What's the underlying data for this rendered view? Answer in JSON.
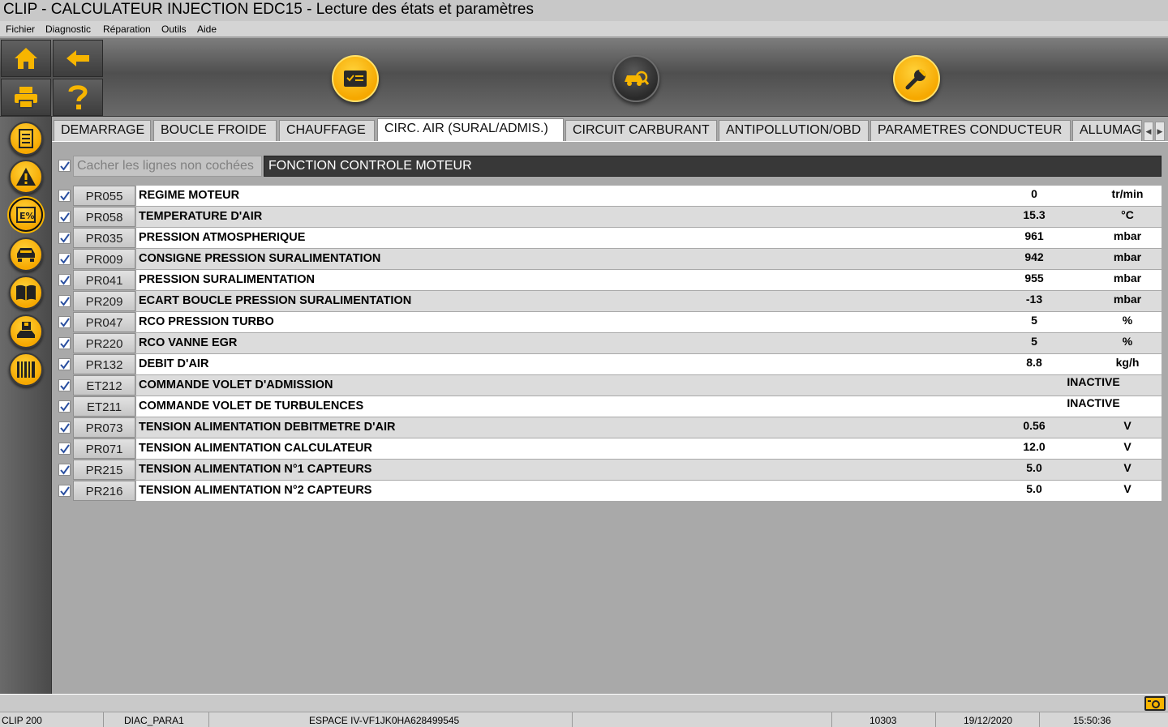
{
  "window": {
    "title": "CLIP - CALCULATEUR INJECTION EDC15 - Lecture des états et paramètres"
  },
  "menu": [
    "Fichier",
    "Diagnostic",
    "Réparation",
    "Outils",
    "Aide"
  ],
  "toolbar": {
    "left_buttons": [
      "home-icon",
      "back-arrow-icon",
      "printer-icon",
      "help-icon"
    ],
    "center_buttons": [
      "checklist-icon",
      "vehicle-diagnostic-icon",
      "wrench-icon"
    ]
  },
  "sidebar": [
    "report-icon",
    "warning-icon",
    "parameters-icon",
    "vehicle-icon",
    "manual-icon",
    "save-vehicle-icon",
    "barcode-icon"
  ],
  "tabs": [
    "DEMARRAGE",
    "BOUCLE FROIDE",
    "CHAUFFAGE",
    "CIRC. AIR (SURAL/ADMIS.)",
    "CIRCUIT CARBURANT",
    "ANTIPOLLUTION/OBD",
    "PARAMETRES CONDUCTEUR",
    "ALLUMAGE"
  ],
  "active_tab": "CIRC. AIR (SURAL/ADMIS.)",
  "panel": {
    "hide_unchecked_label": "Cacher les lignes non cochées",
    "function_header": "FONCTION CONTROLE MOTEUR"
  },
  "rows": [
    {
      "code": "PR055",
      "label": "REGIME MOTEUR",
      "value": "0",
      "unit": "tr/min"
    },
    {
      "code": "PR058",
      "label": "TEMPERATURE D'AIR",
      "value": "15.3",
      "unit": "°C"
    },
    {
      "code": "PR035",
      "label": "PRESSION ATMOSPHERIQUE",
      "value": "961",
      "unit": "mbar"
    },
    {
      "code": "PR009",
      "label": "CONSIGNE PRESSION SURALIMENTATION",
      "value": "942",
      "unit": "mbar"
    },
    {
      "code": "PR041",
      "label": "PRESSION SURALIMENTATION",
      "value": "955",
      "unit": "mbar"
    },
    {
      "code": "PR209",
      "label": "ECART BOUCLE PRESSION SURALIMENTATION",
      "value": "-13",
      "unit": "mbar"
    },
    {
      "code": "PR047",
      "label": "RCO PRESSION TURBO",
      "value": "5",
      "unit": "%"
    },
    {
      "code": "PR220",
      "label": "RCO VANNE EGR",
      "value": "5",
      "unit": "%"
    },
    {
      "code": "PR132",
      "label": "DEBIT D'AIR",
      "value": "8.8",
      "unit": "kg/h"
    },
    {
      "code": "ET212",
      "label": "COMMANDE VOLET D'ADMISSION",
      "state": "INACTIVE"
    },
    {
      "code": "ET211",
      "label": "COMMANDE VOLET DE TURBULENCES",
      "state": "INACTIVE"
    },
    {
      "code": "PR073",
      "label": "TENSION ALIMENTATION DEBITMETRE D'AIR",
      "value": "0.56",
      "unit": "V"
    },
    {
      "code": "PR071",
      "label": "TENSION ALIMENTATION CALCULATEUR",
      "value": "12.0",
      "unit": "V"
    },
    {
      "code": "PR215",
      "label": "TENSION ALIMENTATION N°1 CAPTEURS",
      "value": "5.0",
      "unit": "V"
    },
    {
      "code": "PR216",
      "label": "TENSION ALIMENTATION N°2 CAPTEURS",
      "value": "5.0",
      "unit": "V"
    }
  ],
  "statusbar": {
    "device": "CLIP 200",
    "protocol": "DIAC_PARA1",
    "vehicle": "ESPACE IV-VF1JK0HA628499545",
    "code": "10303",
    "date": "19/12/2020",
    "time": "15:50:36"
  },
  "colors": {
    "accent": "#f7b500",
    "row_odd": "#ffffff",
    "row_even": "#dcdcdc",
    "header_bg": "#383838"
  }
}
